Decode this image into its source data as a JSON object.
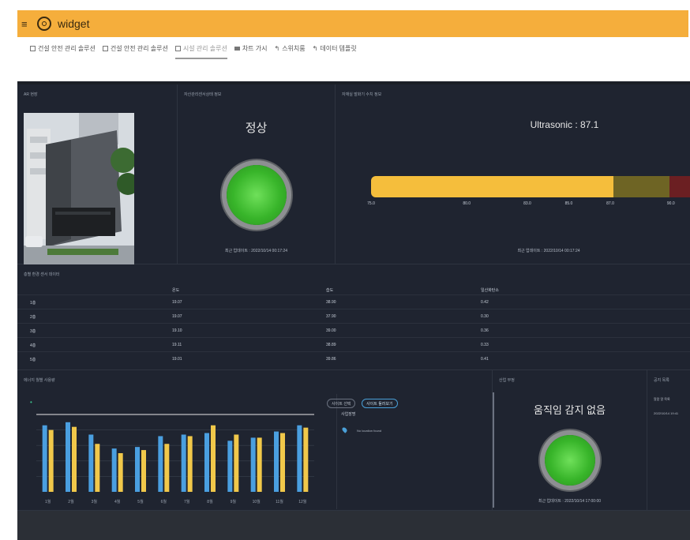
{
  "header": {
    "title": "widget",
    "menu_icon": "hamburger-icon",
    "logo_icon": "circle-logo-icon"
  },
  "tabs": [
    {
      "label": "건설 안전 관리 솔루션",
      "icon": "grid-icon"
    },
    {
      "label": "건설 안전 관리 솔루션",
      "icon": "grid-icon"
    },
    {
      "label": "시설 관리 솔루션",
      "icon": "grid-icon",
      "active": true
    },
    {
      "label": "차트 가시",
      "icon": "card-icon"
    },
    {
      "label": "스위치룸",
      "icon": "share-icon"
    },
    {
      "label": "데이터 템플릿",
      "icon": "share-icon"
    }
  ],
  "cctv": {
    "title": "AR 현장"
  },
  "sensor1": {
    "title": "자산관리센서상태 정보",
    "status": "정상",
    "updated": "최근 업데이트 : 2022/10/14 00:17:24"
  },
  "ultrasonic": {
    "title": "자재실 발화기 수치 정보",
    "label": "Ultrasonic : 87.1",
    "value": 87.1,
    "min": 75.0,
    "max": 90.0,
    "ticks": [
      "75.0",
      "80.0",
      "83.0",
      "85.0",
      "87.0",
      "90.0"
    ],
    "colors": {
      "fill": "#f5be3c",
      "warn": "#6e6424",
      "danger": "#6b1f22"
    },
    "updated": "최근 업데이트 : 2022/10/14 00:17:24"
  },
  "table": {
    "title": "층별 환경 센서 데이터",
    "headers": [
      "온도",
      "습도",
      "일산화탄소"
    ],
    "rows": [
      {
        "floor": "1층",
        "temp": "19.07",
        "hum": "38.90",
        "co": "0.42"
      },
      {
        "floor": "2층",
        "temp": "19.07",
        "hum": "37.90",
        "co": "0.30"
      },
      {
        "floor": "3층",
        "temp": "19.10",
        "hum": "39.00",
        "co": "0.36"
      },
      {
        "floor": "4층",
        "temp": "19.11",
        "hum": "38.89",
        "co": "0.33"
      },
      {
        "floor": "5층",
        "temp": "19.01",
        "hum": "39.86",
        "co": "0.41"
      }
    ]
  },
  "monthly": {
    "title": "에너지 월별 사용량",
    "legend_marker": "•",
    "select_label": "사이트 선택",
    "button_label": "사이트 둘러보기",
    "location_label": "사업장명",
    "location_value": "No location found",
    "chart_data": {
      "type": "bar",
      "categories": [
        "1월",
        "2월",
        "3월",
        "4월",
        "5월",
        "6월",
        "7월",
        "8월",
        "9월",
        "10월",
        "11월",
        "12월"
      ],
      "series": [
        {
          "values": [
            86,
            90,
            74,
            56,
            58,
            72,
            74,
            76,
            66,
            70,
            78,
            86
          ]
        },
        {
          "values": [
            80,
            84,
            62,
            50,
            54,
            62,
            72,
            86,
            74,
            70,
            76,
            83
          ]
        }
      ],
      "colors": [
        "#4a9fe0",
        "#f1c84a"
      ],
      "ylim": [
        0,
        100
      ],
      "reference_line": 100,
      "grid": true
    }
  },
  "sensor2": {
    "title": "산업 부정",
    "status": "움직임 감지 없음",
    "updated": "최근 업데이트 : 2022/10/14 17:00:00"
  },
  "side": {
    "title": "공지 목록",
    "items": [
      "알람 알 목록",
      "2022/10/14 19:41"
    ]
  }
}
